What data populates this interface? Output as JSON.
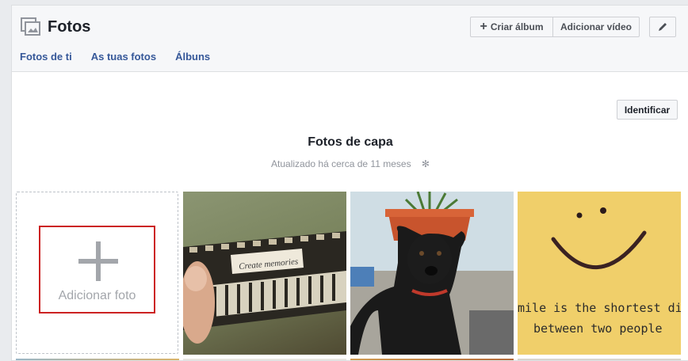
{
  "header": {
    "title": "Fotos",
    "create_album": "Criar álbum",
    "add_video": "Adicionar vídeo"
  },
  "tabs": [
    "Fotos de ti",
    "As tuas fotos",
    "Álbuns"
  ],
  "identify_button": "Identificar",
  "album": {
    "title": "Fotos de capa",
    "updated": "Atualizado há cerca de 11 meses"
  },
  "add_photo": "Adicionar foto",
  "photos": [
    {
      "caption": "Create memories"
    },
    {
      "caption": ""
    },
    {
      "caption_lines": [
        "mile is the shortest dist",
        "between two people"
      ]
    }
  ],
  "colors": {
    "link": "#365899",
    "highlight_border": "#cc2222",
    "header_bg": "#f6f7f9"
  },
  "icons": [
    "photos-icon",
    "plus-icon",
    "pencil-icon",
    "gear-icon"
  ]
}
